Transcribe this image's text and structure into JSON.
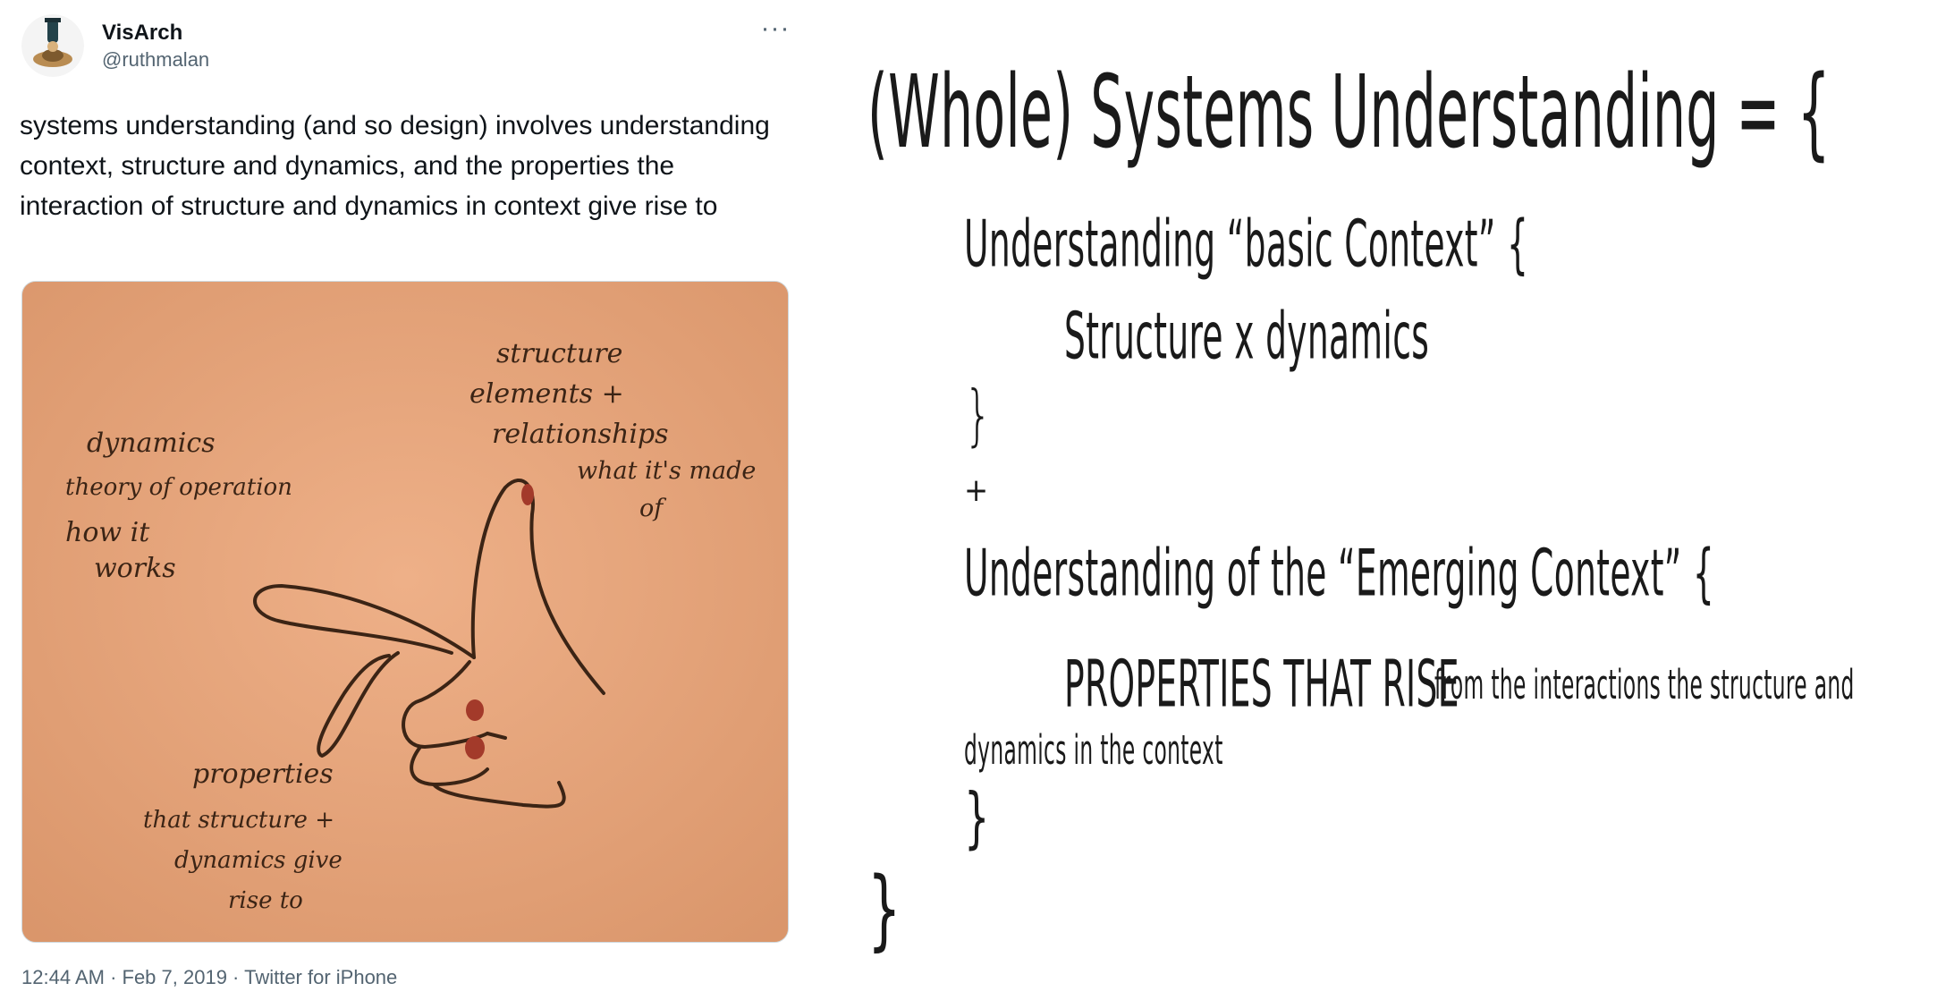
{
  "tweet": {
    "display_name": "VisArch",
    "handle": "@ruthmalan",
    "more_icon": "more-horizontal-icon",
    "text": "systems understanding (and so design) involves understanding context, structure and dynamics, and the properties the interaction of structure and dynamics in context give rise to",
    "timestamp": "12:44 AM · Feb 7, 2019",
    "separator": " · ",
    "source": "Twitter for iPhone"
  },
  "sketch": {
    "background": "#e9a77a",
    "ink": "#3b2415",
    "nail": "#a33a2a",
    "labels": {
      "structure": [
        "structure",
        "elements +",
        "relationships"
      ],
      "made_of": [
        "what it's made",
        "of"
      ],
      "dynamics": [
        "dynamics",
        "theory of operation",
        "how it",
        "works"
      ],
      "properties": [
        "properties",
        "that structure +",
        "dynamics give",
        "rise to"
      ]
    }
  },
  "slide": {
    "title": "(Whole) Systems Understanding = {",
    "basic_context": "Understanding “basic Context” {",
    "structure_x_dynamics": "Structure x dynamics",
    "close_brace_1": "}",
    "plus": "+",
    "emerging_context": "Understanding of the “Emerging Context”  {",
    "properties_big": "PROPERTIES  THAT RISE",
    "properties_small": "from the interactions the structure and",
    "properties_cont": "dynamics in the context",
    "close_brace_2": "}",
    "close_brace_outer": "}"
  }
}
